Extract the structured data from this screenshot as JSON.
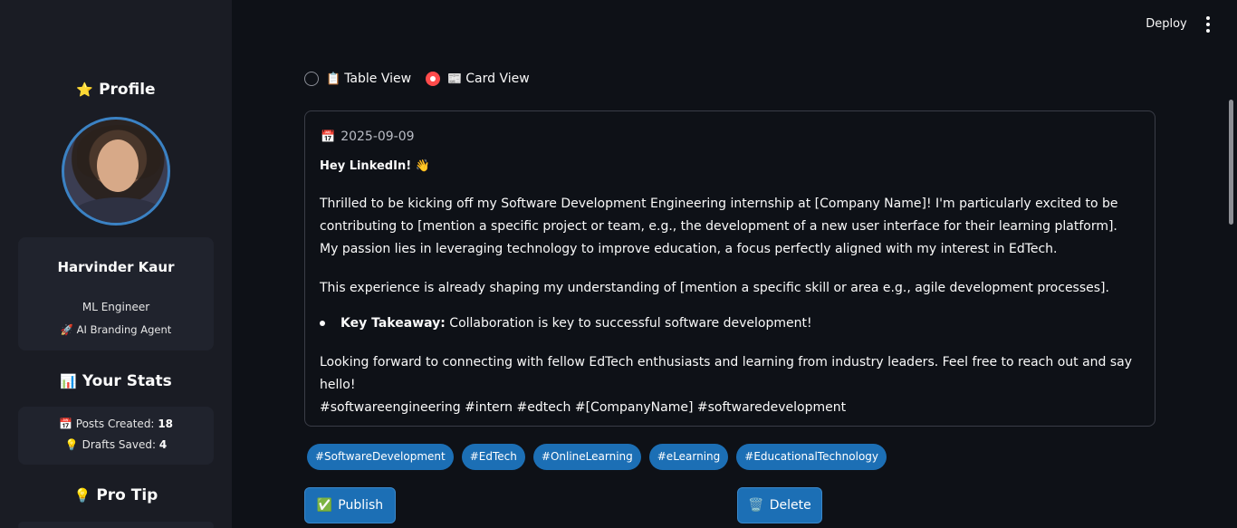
{
  "sidebar": {
    "profile_heading": {
      "emoji": "⭐",
      "text": "Profile"
    },
    "profile": {
      "name": "Harvinder Kaur",
      "role": "ML Engineer",
      "agent": {
        "emoji": "🚀",
        "text": "AI Branding Agent"
      }
    },
    "stats_heading": {
      "emoji": "📊",
      "text": "Your Stats"
    },
    "stats": [
      {
        "emoji": "📅",
        "label": "Posts Created:",
        "value": "18"
      },
      {
        "emoji": "💡",
        "label": "Drafts Saved:",
        "value": "4"
      }
    ],
    "tip_heading": {
      "emoji": "💡",
      "text": "Pro Tip"
    }
  },
  "topbar": {
    "deploy_label": "Deploy",
    "menu_icon": "kebab-menu-icon"
  },
  "view_toggle": {
    "options": [
      {
        "emoji": "📋",
        "label": "Table View",
        "selected": false
      },
      {
        "emoji": "📰",
        "label": "Card View",
        "selected": true
      }
    ]
  },
  "post": {
    "date_emoji": "📅",
    "date": "2025-09-09",
    "greeting": "Hey LinkedIn! 👋",
    "paragraph1": "Thrilled to be kicking off my Software Development Engineering internship at [Company Name]! I'm particularly excited to be contributing to [mention a specific project or team, e.g., the development of a new user interface for their learning platform]. My passion lies in leveraging technology to improve education, a focus perfectly aligned with my interest in EdTech.",
    "paragraph2": "This experience is already shaping my understanding of [mention a specific skill or area e.g., agile development processes].",
    "bullet_bold": "Key Takeaway:",
    "bullet_text": " Collaboration is key to successful software development!",
    "paragraph3": "Looking forward to connecting with fellow EdTech enthusiasts and learning from industry leaders. Feel free to reach out and say hello!",
    "hashtags_line": "#softwareengineering #intern #edtech #[CompanyName] #softwaredevelopment"
  },
  "hashtag_chips": [
    "#SoftwareDevelopment",
    "#EdTech",
    "#OnlineLearning",
    "#eLearning",
    "#EducationalTechnology"
  ],
  "actions": {
    "publish": {
      "emoji": "✅",
      "label": "Publish"
    },
    "delete": {
      "emoji": "🗑️",
      "label": "Delete"
    }
  },
  "colors": {
    "background": "#0e1117",
    "sidebar": "#1a1c24",
    "accent": "#1c6fb5",
    "radio_selected": "#ff4b4b"
  }
}
